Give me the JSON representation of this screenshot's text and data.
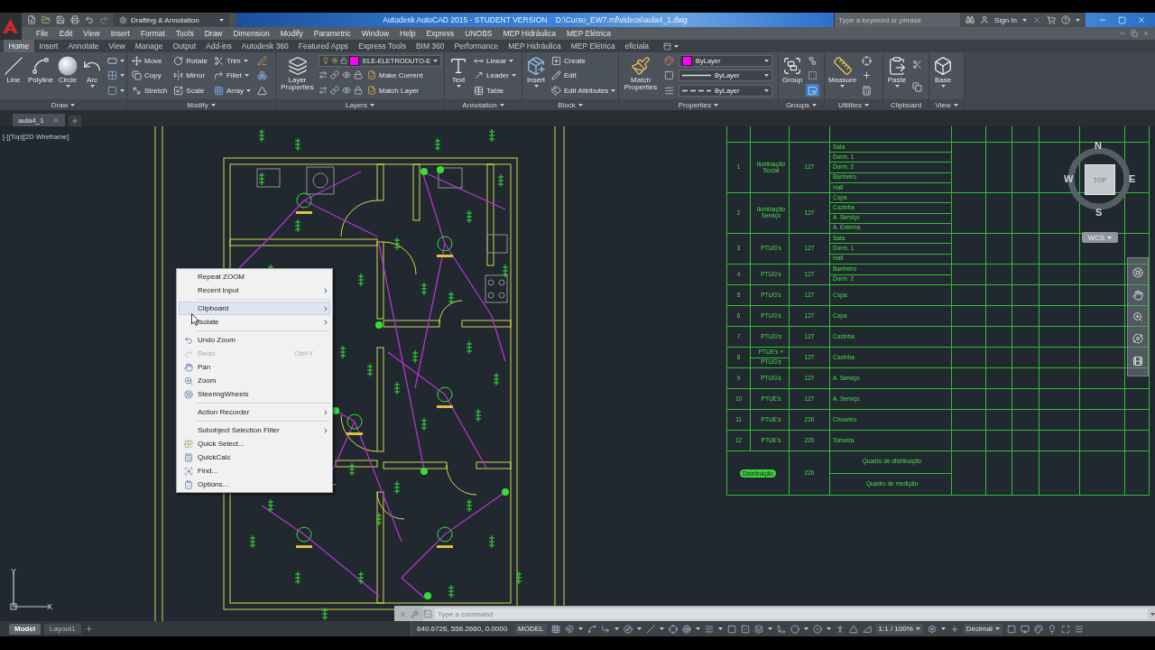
{
  "title_bar": {
    "workspace": "Drafting & Annotation",
    "title": "Autodesk AutoCAD 2015 - STUDENT VERSION    D:\\Curso_EW7.mf\\videos\\aula4_1.dwg",
    "search": {
      "placeholder": "Type a keyword or phrase"
    },
    "sign_in": "Sign In"
  },
  "menu_bar": [
    "File",
    "Edit",
    "View",
    "Insert",
    "Format",
    "Tools",
    "Draw",
    "Dimension",
    "Modify",
    "Parametric",
    "Window",
    "Help",
    "Express",
    "UNOBS",
    "MEP Hidráulica",
    "MEP Elétrica"
  ],
  "ribbon_tabs": [
    {
      "label": "Home",
      "selected": true
    },
    {
      "label": "Insert",
      "selected": false
    },
    {
      "label": "Annotate",
      "selected": false
    },
    {
      "label": "View",
      "selected": false
    },
    {
      "label": "Manage",
      "selected": false
    },
    {
      "label": "Output",
      "selected": false
    },
    {
      "label": "Add-ins",
      "selected": false
    },
    {
      "label": "Autodesk 360",
      "selected": false
    },
    {
      "label": "Featured Apps",
      "selected": false
    },
    {
      "label": "Express Tools",
      "selected": false
    },
    {
      "label": "BIM 360",
      "selected": false
    },
    {
      "label": "Performance",
      "selected": false
    },
    {
      "label": "MEP Hidráulica",
      "selected": false
    },
    {
      "label": "MEP Elétrica",
      "selected": false
    },
    {
      "label": "eficiala",
      "selected": false
    }
  ],
  "ribbon_panels": [
    {
      "title": "Draw",
      "menu": true,
      "groups": [
        {
          "kind": "large",
          "label": "Line",
          "dropdown": false
        },
        {
          "kind": "large",
          "label": "Polyline",
          "dropdown": false
        },
        {
          "kind": "large",
          "label": "Circle",
          "dropdown": true
        },
        {
          "kind": "large",
          "label": "Arc",
          "dropdown": true
        },
        {
          "kind": "small",
          "items": [
            {
              "kind": "button",
              "dropdown": true
            },
            {
              "kind": "button",
              "dropdown": true
            },
            {
              "kind": "button",
              "dropdown": true
            }
          ]
        }
      ]
    },
    {
      "title": "Modify",
      "menu": true,
      "groups": [
        {
          "kind": "small",
          "items": [
            {
              "kind": "button",
              "label": "Move",
              "dropdown": false
            },
            {
              "kind": "button",
              "label": "Copy",
              "dropdown": false
            },
            {
              "kind": "button",
              "label": "Stretch",
              "dropdown": false
            }
          ]
        },
        {
          "kind": "small",
          "items": [
            {
              "kind": "button",
              "label": "Rotate",
              "dropdown": false
            },
            {
              "kind": "button",
              "label": "Mirror",
              "dropdown": false
            },
            {
              "kind": "button",
              "label": "Scale",
              "dropdown": false
            }
          ]
        },
        {
          "kind": "small",
          "items": [
            {
              "kind": "button",
              "label": "Trim",
              "dropdown": true
            },
            {
              "kind": "button",
              "label": "Fillet",
              "dropdown": true
            },
            {
              "kind": "button",
              "label": "Array",
              "dropdown": true
            }
          ]
        },
        {
          "kind": "small",
          "items": [
            {
              "kind": "button",
              "dropdown": false
            },
            {
              "kind": "button",
              "dropdown": false
            },
            {
              "kind": "button",
              "dropdown": false
            }
          ]
        }
      ]
    },
    {
      "title": "Layers",
      "menu": true,
      "groups": [
        {
          "kind": "large",
          "label": "Layer Properties",
          "dropdown": false
        },
        {
          "kind": "small",
          "items": [
            {
              "kind": "layer_combo",
              "value": "ELE-ELETRODUTO-E",
              "color": "#ff00ff"
            },
            {
              "kind": "tool_row",
              "label": "Make Current"
            },
            {
              "kind": "tool_row",
              "label": "Match Layer"
            }
          ]
        }
      ]
    },
    {
      "title": "Annotation",
      "menu": true,
      "groups": [
        {
          "kind": "large",
          "label": "Text",
          "dropdown": true
        },
        {
          "kind": "small",
          "items": [
            {
              "kind": "button",
              "label": "Linear",
              "dropdown": true
            },
            {
              "kind": "button",
              "label": "Leader",
              "dropdown": true
            },
            {
              "kind": "button",
              "label": "Table",
              "dropdown": false
            }
          ]
        }
      ]
    },
    {
      "title": "Block",
      "menu": true,
      "groups": [
        {
          "kind": "large",
          "label": "Insert",
          "dropdown": true
        },
        {
          "kind": "small",
          "items": [
            {
              "kind": "button",
              "label": "Create",
              "dropdown": false
            },
            {
              "kind": "button",
              "label": "Edit",
              "dropdown": false
            },
            {
              "kind": "button",
              "label": "Edit Attributes",
              "dropdown": true
            }
          ]
        }
      ]
    },
    {
      "title": "Properties",
      "menu": true,
      "groups": [
        {
          "kind": "large",
          "label": "Match Properties",
          "dropdown": false
        },
        {
          "kind": "small",
          "items": [
            {
              "kind": "button",
              "dropdown": false
            },
            {
              "kind": "button",
              "dropdown": false
            },
            {
              "kind": "button",
              "dropdown": false
            }
          ]
        },
        {
          "kind": "small",
          "items": [
            {
              "kind": "combo",
              "value": "ByLayer",
              "color": "#ff00ff"
            },
            {
              "kind": "combo",
              "value": "ByLayer",
              "dashed": false
            },
            {
              "kind": "combo",
              "value": "ByLayer",
              "dashed": true
            }
          ]
        }
      ]
    },
    {
      "title": "Groups",
      "menu": true,
      "groups": [
        {
          "kind": "large",
          "label": "Group",
          "dropdown": false
        },
        {
          "kind": "small",
          "items": [
            {
              "kind": "button",
              "dropdown": false,
              "on": false
            },
            {
              "kind": "button",
              "dropdown": false,
              "on": false
            },
            {
              "kind": "button",
              "dropdown": false,
              "on": true
            }
          ]
        }
      ]
    },
    {
      "title": "Utilities",
      "menu": true,
      "groups": [
        {
          "kind": "large",
          "label": "Measure",
          "dropdown": true
        },
        {
          "kind": "small",
          "items": [
            {
              "kind": "button",
              "dropdown": false
            },
            {
              "kind": "button",
              "dropdown": false
            },
            {
              "kind": "button",
              "dropdown": false
            }
          ]
        }
      ]
    },
    {
      "title": "Clipboard",
      "menu": false,
      "groups": [
        {
          "kind": "large",
          "label": "Paste",
          "dropdown": true
        },
        {
          "kind": "small",
          "items": [
            {
              "kind": "button",
              "dropdown": false
            },
            {
              "kind": "button",
              "dropdown": false
            }
          ]
        }
      ]
    },
    {
      "title": "View",
      "menu": true,
      "groups": [
        {
          "kind": "large",
          "label": "Base",
          "dropdown": true
        }
      ]
    }
  ],
  "file_tabs": [
    {
      "label": "aula4_1",
      "selected": true
    }
  ],
  "viewport": {
    "label": "[-][Top][2D Wireframe]"
  },
  "load_table": {
    "rows": [
      {
        "circuit": "1",
        "description": [
          "Iluminação Social"
        ],
        "voltage": "127",
        "rooms": [
          "Sala",
          "Dorm. 1",
          "Dorm. 2",
          "Banheiro",
          "Hall"
        ]
      },
      {
        "circuit": "2",
        "description": [
          "Iluminação Serviço"
        ],
        "voltage": "127",
        "rooms": [
          "Copa",
          "Cozinha",
          "A. Serviço",
          "A. Externa"
        ]
      },
      {
        "circuit": "3",
        "description": [
          "PTUG's"
        ],
        "voltage": "127",
        "rooms": [
          "Sala",
          "Dorm. 1",
          "Hall"
        ]
      },
      {
        "circuit": "4",
        "description": [
          "PTUG's"
        ],
        "voltage": "127",
        "rooms": [
          "Banheiro",
          "Dorm. 2"
        ]
      },
      {
        "circuit": "5",
        "description": [
          "PTUG's"
        ],
        "voltage": "127",
        "rooms": [
          "Copa"
        ]
      },
      {
        "circuit": "6",
        "description": [
          "PTUG's"
        ],
        "voltage": "127",
        "rooms": [
          "Copa"
        ]
      },
      {
        "circuit": "7",
        "description": [
          "PTUG's"
        ],
        "voltage": "127",
        "rooms": [
          "Cozinha"
        ]
      },
      {
        "circuit": "8",
        "description": [
          "PTUE's +",
          "PTUG's"
        ],
        "voltage": "127",
        "rooms": [
          "Cozinha"
        ]
      },
      {
        "circuit": "9",
        "description": [
          "PTUG's"
        ],
        "voltage": "127",
        "rooms": [
          "A. Serviço"
        ]
      },
      {
        "circuit": "10",
        "description": [
          "PTUE's"
        ],
        "voltage": "127",
        "rooms": [
          "A. Serviço"
        ]
      },
      {
        "circuit": "11",
        "description": [
          "PTUE's"
        ],
        "voltage": "220",
        "rooms": [
          "Chuveiro"
        ]
      },
      {
        "circuit": "12",
        "description": [
          "PTUE's"
        ],
        "voltage": "220",
        "rooms": [
          "Torneira"
        ]
      }
    ],
    "total": {
      "description": "Distribuição",
      "voltage": "220",
      "rooms": [
        "Quadro de distribuição",
        "Quadro de medição"
      ]
    }
  },
  "viewcube": {
    "face": "TOP",
    "directions": [
      "N",
      "W",
      "E",
      "S"
    ],
    "coordinate_system": "WCS"
  },
  "context_menu": [
    {
      "kind": "item",
      "label": "Repeat ZOOM",
      "submenu": false,
      "disabled": false,
      "highlighted": false
    },
    {
      "kind": "item",
      "label": "Recent Input",
      "submenu": true,
      "disabled": false,
      "highlighted": false
    },
    {
      "kind": "separator"
    },
    {
      "kind": "item",
      "label": "Clipboard",
      "submenu": true,
      "disabled": false,
      "highlighted": true
    },
    {
      "kind": "item",
      "label": "Isolate",
      "submenu": true,
      "disabled": false,
      "highlighted": false
    },
    {
      "kind": "separator"
    },
    {
      "kind": "item",
      "label": "Undo Zoom",
      "submenu": false,
      "disabled": false,
      "highlighted": false
    },
    {
      "kind": "item",
      "label": "Redo",
      "shortcut": "Ctrl+Y",
      "submenu": false,
      "disabled": true,
      "highlighted": false
    },
    {
      "kind": "item",
      "label": "Pan",
      "submenu": false,
      "disabled": false,
      "highlighted": false
    },
    {
      "kind": "item",
      "label": "Zoom",
      "submenu": false,
      "disabled": false,
      "highlighted": false
    },
    {
      "kind": "item",
      "label": "SteeringWheels",
      "submenu": false,
      "disabled": false,
      "highlighted": false
    },
    {
      "kind": "separator"
    },
    {
      "kind": "item",
      "label": "Action Recorder",
      "submenu": true,
      "disabled": false,
      "highlighted": false
    },
    {
      "kind": "separator"
    },
    {
      "kind": "item",
      "label": "Subobject Selection Filter",
      "submenu": true,
      "disabled": false,
      "highlighted": false
    },
    {
      "kind": "item",
      "label": "Quick Select...",
      "submenu": false,
      "disabled": false,
      "highlighted": false
    },
    {
      "kind": "item",
      "label": "QuickCalc",
      "submenu": false,
      "disabled": false,
      "highlighted": false
    },
    {
      "kind": "item",
      "label": "Find...",
      "submenu": false,
      "disabled": false,
      "highlighted": false
    },
    {
      "kind": "item",
      "label": "Options...",
      "submenu": false,
      "disabled": false,
      "highlighted": false
    }
  ],
  "ucs": {
    "x": "X",
    "y": "Y"
  },
  "command_line": {
    "placeholder": "Type a command"
  },
  "status_bar": {
    "layout_tabs": [
      {
        "label": "Model",
        "selected": true
      },
      {
        "label": "Layout1",
        "selected": false
      }
    ],
    "coordinates": "640.6726, 556.2660, 0.0000",
    "space": "MODEL",
    "annotation_scale": "1:1 / 100%",
    "units": "Decimal"
  }
}
